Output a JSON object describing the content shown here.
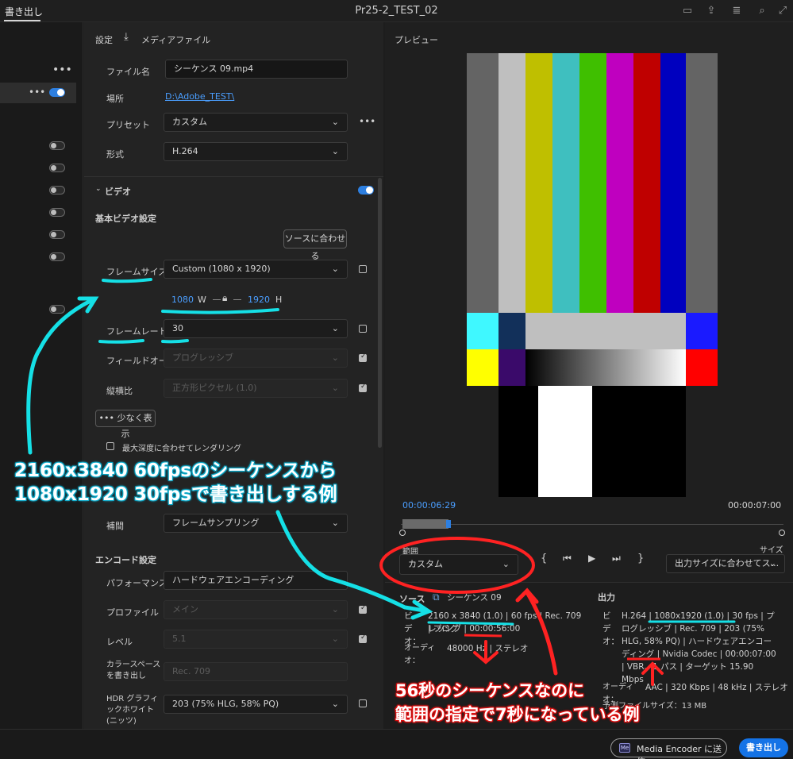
{
  "topbar": {
    "tab": "書き出し",
    "title": "Pr25-2_TEST_02"
  },
  "settings": {
    "header_label": "設定",
    "media_file": "メディアファイル",
    "filename_label": "ファイル名",
    "filename_value": "シーケンス 09.mp4",
    "location_label": "場所",
    "location_value": "D:\\Adobe_TEST\\",
    "preset_label": "プリセット",
    "preset_value": "カスタム",
    "format_label": "形式",
    "format_value": "H.264",
    "video_label": "ビデオ",
    "basic_video": "基本ビデオ設定",
    "match_source": "ソースに合わせる",
    "frame_size_label": "フレームサイズ",
    "frame_size_value": "Custom (1080 x 1920)",
    "width": "1080",
    "w": "W",
    "height": "1920",
    "h": "H",
    "frame_rate_label": "フレームレート",
    "frame_rate_value": "30",
    "field_order_label": "フィールドオーダー",
    "field_order_value": "プログレッシブ",
    "aspect_label": "縦横比",
    "aspect_value": "正方形ピクセル (1.0)",
    "show_less": "少なく表示",
    "max_depth": "最大深度に合わせてレンダリング",
    "interp_label": "補間",
    "interp_value": "フレームサンプリング",
    "encode_label": "エンコード設定",
    "perf_label": "パフォーマンス",
    "perf_value": "ハードウェアエンコーディング",
    "profile_label": "プロファイル",
    "profile_value": "メイン",
    "level_label": "レベル",
    "level_value": "5.1",
    "colorspace_label": "カラースペースを書き出し",
    "colorspace_value": "Rec. 709",
    "hdr_label": "HDR グラフィックホワイト (ニッツ)",
    "hdr_value": "203 (75% HLG, 58% PQ)"
  },
  "preview": {
    "title": "プレビュー",
    "time_current": "00:00:06:29",
    "time_end": "00:00:07:00",
    "range_label": "範囲",
    "range_value": "カスタム",
    "size_label": "サイズ",
    "size_value": "出力サイズに合わせてス..."
  },
  "source": {
    "label": "ソース",
    "seq": "シーケンス 09",
    "video_prefix": "ビデオ：",
    "video_line1": "2160 x 3840 (1.0) | 60 fps | Rec. 709 | プログ",
    "video_line2": "レッシブ | 00:00:56:00",
    "audio_prefix": "オーディオ：",
    "audio_line": "48000 Hz | ステレオ"
  },
  "output": {
    "label": "出力",
    "video_prefix": "ビデオ：",
    "video_text": "H.264 | 1080x1920 (1.0) | 30 fps | プログレッシブ | Rec. 709 | 203 (75% HLG, 58% PQ) | ハードウェアエンコーディング | Nvidia Codec | 00:00:07:00 | VBR、1 パス | ターゲット 15.90 Mbps",
    "audio_prefix": "オーディオ：",
    "audio_text": "AAC | 320 Kbps | 48 kHz | ステレオ",
    "filesize_text": "予測ファイルサイズ：13 MB"
  },
  "bottom": {
    "send_me": "Media Encoder に送信",
    "export": "書き出し"
  },
  "annotations": {
    "cyan_line1": "2160x3840 60fpsのシーケンスから",
    "cyan_line2": "1080x1920 30fpsで書き出しする例",
    "red_line1": "56秒のシーケンスなのに",
    "red_line2": "範囲の指定で7秒になっている例"
  },
  "colors": {
    "accent": "#2d7fe0",
    "cyan_annotation": "#15e0e6",
    "red_annotation": "#ff2222"
  }
}
